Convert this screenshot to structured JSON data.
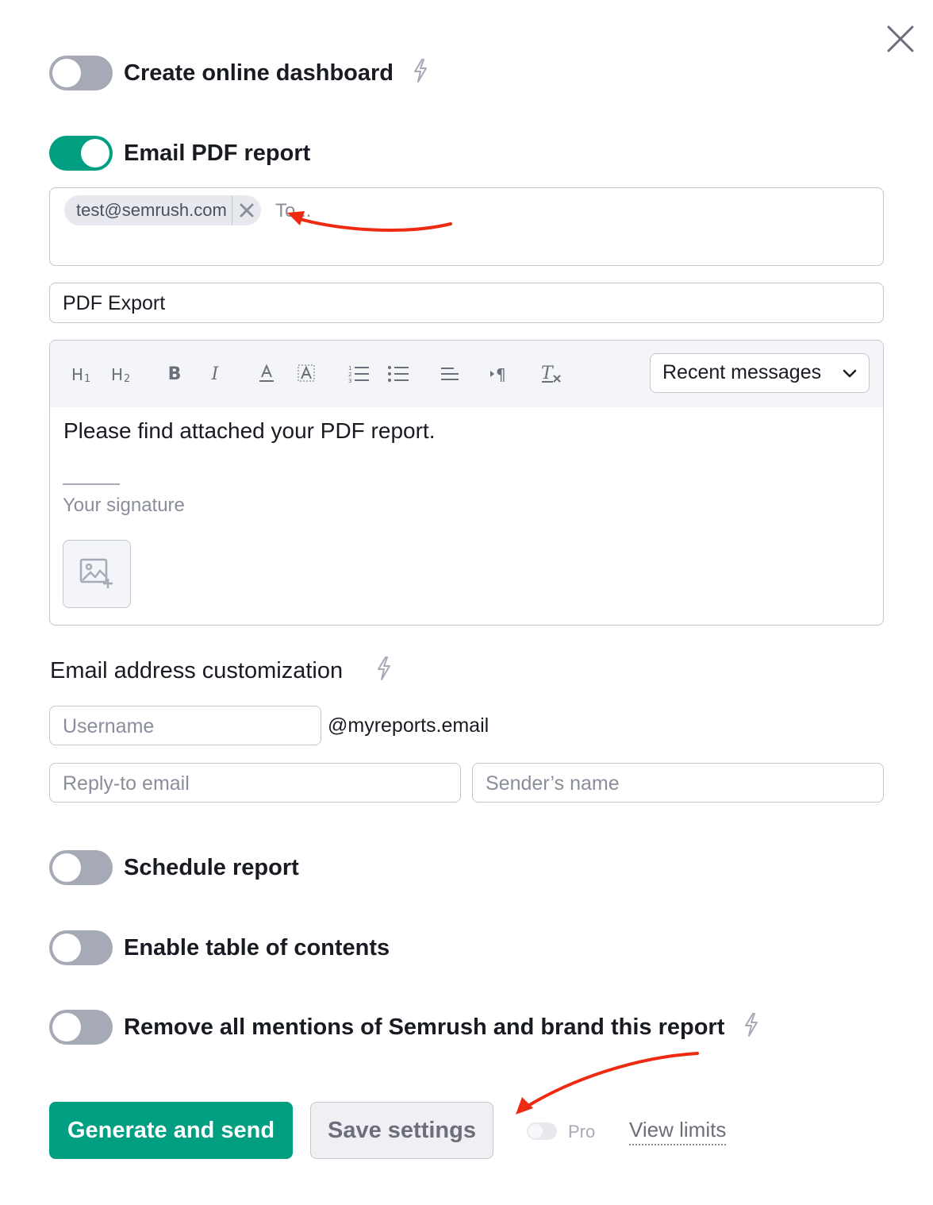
{
  "toggles": {
    "dashboard": {
      "label": "Create online dashboard",
      "on": false
    },
    "email_pdf": {
      "label": "Email PDF report",
      "on": true
    },
    "schedule": {
      "label": "Schedule report",
      "on": false
    },
    "toc": {
      "label": "Enable table of contents",
      "on": false
    },
    "branding": {
      "label": "Remove all mentions of Semrush and brand this report",
      "on": false
    }
  },
  "recipients": {
    "chips": [
      "test@semrush.com"
    ],
    "placeholder": "To..."
  },
  "subject": {
    "value": "PDF Export"
  },
  "editor": {
    "toolbar": {
      "h1": "H1",
      "h2": "H2",
      "bold": "B",
      "italic": "I",
      "text_color": "A",
      "highlight": "A",
      "ordered_list": "ordered-list-icon",
      "bullet_list": "bullet-list-icon",
      "align": "align-icon",
      "direction": "¶",
      "clear": "T"
    },
    "recent_messages_label": "Recent messages",
    "body": "Please find attached your PDF report.",
    "signature_placeholder": "Your signature"
  },
  "customization": {
    "title": "Email address customization",
    "username_placeholder": "Username",
    "domain_suffix": "@myreports.email",
    "reply_to_placeholder": "Reply-to email",
    "sender_name_placeholder": "Sender’s name"
  },
  "actions": {
    "generate_label": "Generate and send",
    "save_label": "Save settings",
    "pro_label": "Pro",
    "view_limits_label": "View limits"
  },
  "colors": {
    "accent": "#009f81",
    "toggle_off": "#a6a9b6",
    "annotation_arrow": "#ee2b12"
  }
}
